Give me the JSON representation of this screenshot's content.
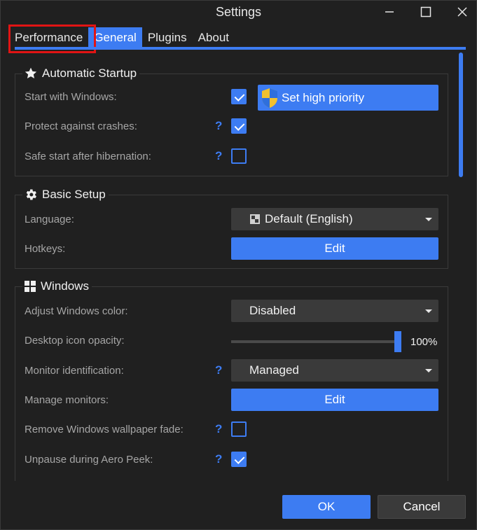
{
  "window": {
    "title": "Settings"
  },
  "tabs": [
    {
      "label": "Performance"
    },
    {
      "label": "General"
    },
    {
      "label": "Plugins"
    },
    {
      "label": "About"
    }
  ],
  "active_tab": "General",
  "accent_color": "#3d7cf2",
  "highlight_color": "#e11414",
  "automatic_startup": {
    "title": "Automatic Startup",
    "icon": "star-icon",
    "start_with_windows": {
      "label": "Start with Windows:",
      "checked": true
    },
    "high_priority_button": "Set high priority",
    "protect_against_crashes": {
      "label": "Protect against crashes:",
      "help": "?",
      "checked": true
    },
    "safe_start": {
      "label": "Safe start after hibernation:",
      "help": "?",
      "checked": false
    }
  },
  "basic_setup": {
    "title": "Basic Setup",
    "icon": "gear-icon",
    "language": {
      "label": "Language:",
      "value": "Default (English)"
    },
    "hotkeys": {
      "label": "Hotkeys:",
      "button": "Edit"
    }
  },
  "windows": {
    "title": "Windows",
    "icon": "windows-logo-icon",
    "adjust_color": {
      "label": "Adjust Windows color:",
      "value": "Disabled"
    },
    "desktop_opacity": {
      "label": "Desktop icon opacity:",
      "value": "100%",
      "level": 1.0
    },
    "monitor_identification": {
      "label": "Monitor identification:",
      "help": "?",
      "value": "Managed"
    },
    "manage_monitors": {
      "label": "Manage monitors:",
      "button": "Edit"
    },
    "remove_fade": {
      "label": "Remove Windows wallpaper fade:",
      "help": "?",
      "checked": false
    },
    "unpause_aero": {
      "label": "Unpause during Aero Peek:",
      "help": "?",
      "checked": true
    }
  },
  "footer": {
    "ok": "OK",
    "cancel": "Cancel"
  }
}
